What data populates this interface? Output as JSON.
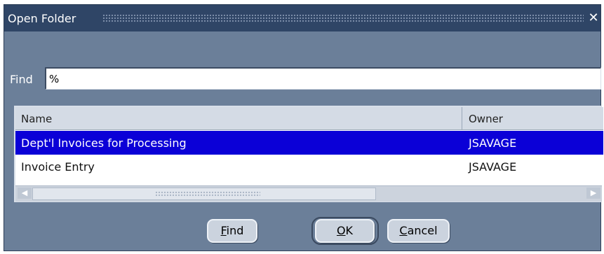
{
  "window": {
    "title": "Open Folder",
    "close_glyph": "✕"
  },
  "find": {
    "label": "Find",
    "value": "%"
  },
  "table": {
    "columns": [
      "Name",
      "Owner"
    ],
    "rows": [
      {
        "name": "Dept'l Invoices for Processing",
        "owner": "JSAVAGE",
        "selected": true
      },
      {
        "name": "Invoice Entry",
        "owner": "JSAVAGE",
        "selected": false
      }
    ],
    "scroll_left_icon": "arrow-left-icon",
    "scroll_right_icon": "arrow-right-icon"
  },
  "buttons": {
    "find": {
      "mnemonic": "F",
      "rest": "ind"
    },
    "ok": {
      "mnemonic": "O",
      "rest": "K"
    },
    "cancel": {
      "mnemonic": "C",
      "rest": "ancel"
    }
  },
  "colors": {
    "titlebar": "#2f4566",
    "dialog_bg": "#6b7f99",
    "selection": "#0b00d7"
  }
}
